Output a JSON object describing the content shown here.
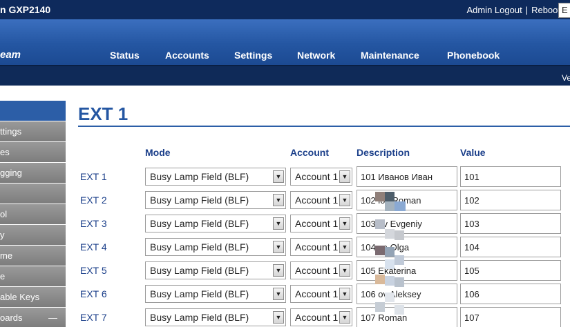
{
  "header": {
    "model": "n GXP2140",
    "links": [
      "Admin Logout",
      "Reboot"
    ],
    "language": "E"
  },
  "logo": "eam",
  "nav": [
    "Status",
    "Accounts",
    "Settings",
    "Network",
    "Maintenance",
    "Phonebook"
  ],
  "version": "Ve",
  "sidebar": {
    "items": [
      "ttings",
      "es",
      "gging",
      "",
      "ol",
      "y",
      "me",
      "e",
      "able Keys",
      "oards"
    ],
    "collapse_symbol": "—"
  },
  "page_title": "EXT 1",
  "columns": {
    "mode": "Mode",
    "account": "Account",
    "description": "Description",
    "value": "Value"
  },
  "rows": [
    {
      "label": "EXT 1",
      "mode": "Busy Lamp Field (BLF)",
      "account": "Account 1",
      "description": "101 Иванов Иван",
      "value": "101"
    },
    {
      "label": "EXT 2",
      "mode": "Busy Lamp Field (BLF)",
      "account": "Account 1",
      "description": "102    lov Roman",
      "value": "102"
    },
    {
      "label": "EXT 3",
      "mode": "Busy Lamp Field (BLF)",
      "account": "Account 1",
      "description": "103    ov Evgeniy",
      "value": "103"
    },
    {
      "label": "EXT 4",
      "mode": "Busy Lamp Field (BLF)",
      "account": "Account 1",
      "description": "104    va Olga",
      "value": "104"
    },
    {
      "label": "EXT 5",
      "mode": "Busy Lamp Field (BLF)",
      "account": "Account 1",
      "description": "105    Ekaterina",
      "value": "105"
    },
    {
      "label": "EXT 6",
      "mode": "Busy Lamp Field (BLF)",
      "account": "Account 1",
      "description": "106    ov Aleksey",
      "value": "106"
    },
    {
      "label": "EXT 7",
      "mode": "Busy Lamp Field (BLF)",
      "account": "Account 1",
      "description": "107    Roman",
      "value": "107"
    }
  ],
  "colors": {
    "topbar": "#0e2a5c",
    "navbar": "#2456a2",
    "title": "#2456a2",
    "label": "#1b3f8a"
  }
}
